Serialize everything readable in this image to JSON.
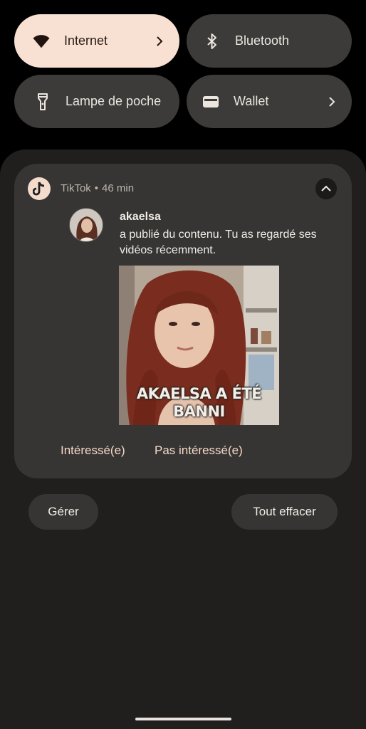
{
  "quick_settings": {
    "internet": {
      "label": "Internet",
      "icon": "wifi-icon",
      "active": true,
      "has_chevron": true
    },
    "bluetooth": {
      "label": "Bluetooth",
      "icon": "bluetooth-icon",
      "active": false
    },
    "flashlight": {
      "label": "Lampe de poche",
      "icon": "flashlight-icon",
      "active": false
    },
    "wallet": {
      "label": "Wallet",
      "icon": "wallet-icon",
      "active": false,
      "has_chevron": true
    }
  },
  "notification": {
    "app_name": "TikTok",
    "separator": "•",
    "time": "46 min",
    "app_icon": "tiktok-icon",
    "sender": "akaelsa",
    "message": "a publié du contenu. Tu as regardé ses vidéos récemment.",
    "thumbnail_overlay_text": "AKAELSA A ÉTÉ BANNI",
    "actions": {
      "interested": "Intéressé(e)",
      "not_interested": "Pas intéressé(e)"
    }
  },
  "buttons": {
    "manage": "Gérer",
    "clear_all": "Tout effacer"
  },
  "colors": {
    "active_tile": "#f8e1d3",
    "tile": "#3c3b3a",
    "shade": "#201f1d",
    "card": "#363533",
    "action_text": "#f5d9c8"
  }
}
